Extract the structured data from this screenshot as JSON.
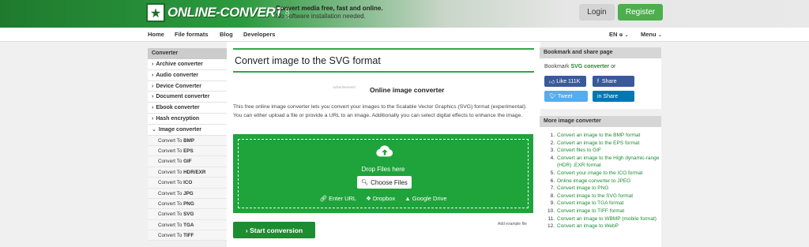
{
  "header": {
    "logo_text": "ONLINE-CONVERT",
    "logo_suffix": ".COM",
    "tagline_1": "Convert media free, fast and online.",
    "tagline_2": "No software installation needed.",
    "login": "Login",
    "register": "Register"
  },
  "nav": {
    "home": "Home",
    "file_formats": "File formats",
    "blog": "Blog",
    "developers": "Developers",
    "lang": "EN",
    "menu": "Menu"
  },
  "sidebar": {
    "heading": "Converter",
    "categories": [
      "Archive converter",
      "Audio converter",
      "Device Converter",
      "Document converter",
      "Ebook converter",
      "Hash encryption"
    ],
    "active": "Image converter",
    "sub_prefix": "Convert To",
    "formats": [
      "BMP",
      "EPS",
      "GIF",
      "HDR/EXR",
      "ICO",
      "JPG",
      "PNG",
      "SVG",
      "TGA",
      "TIFF"
    ]
  },
  "main": {
    "title": "Convert image to the SVG format",
    "ad_label": "Advertisement",
    "subtitle": "Online image converter",
    "description": "This free online image converter lets you convert your images to the Scalable Vector Graphics (SVG) format (experimental). You can either upload a file or provide a URL to an image. Additionally you can select digital effects to enhance the image.",
    "drop_text": "Drop Files here",
    "choose_files": "Choose Files",
    "enter_url": "Enter URL",
    "dropbox": "Dropbox",
    "google_drive": "Google Drive",
    "start": "Start conversion",
    "add_example": "Add example file"
  },
  "bookmark": {
    "heading": "Bookmark and share page",
    "text_prefix": "Bookmark",
    "text_link": "SVG converter",
    "text_suffix": "or",
    "like": "Like 111K",
    "share_fb": "Share",
    "tweet": "Tweet",
    "share_li": "Share"
  },
  "more": {
    "heading": "More image converter",
    "items": [
      "Convert an image to the BMP format",
      "Convert an image to the EPS format",
      "Convert files to GIF",
      "Convert an image to the High dynamic-range (HDR) .EXR format",
      "Convert your image to the ICO format",
      "Online image converter to JPEG",
      "Convert image to PNG",
      "Convert image to the SVG format",
      "Convert image to TGA format",
      "Convert image to TIFF format",
      "Convert an image to WBMP (mobile format)",
      "Convert an image to WebP"
    ]
  },
  "colors": {
    "brand_green": "#1fa33b",
    "link_green": "#1d8c32",
    "facebook": "#3b5998",
    "twitter": "#55acee",
    "linkedin": "#0077b5"
  }
}
